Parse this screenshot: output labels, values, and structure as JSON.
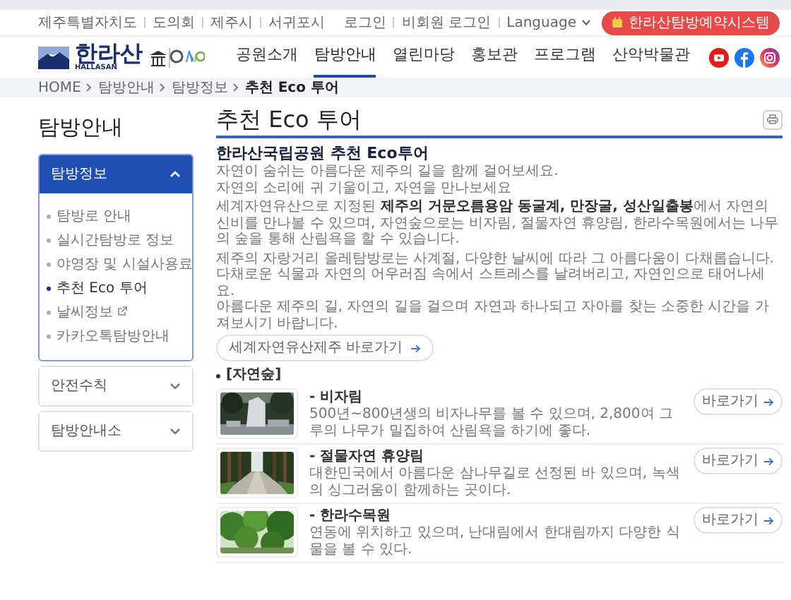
{
  "top_links": [
    "제주특별자치도",
    "도의회",
    "제주시",
    "서귀포시"
  ],
  "account_links": [
    "로그인",
    "비회원 로그인"
  ],
  "language": {
    "label": "Language"
  },
  "reservation_button": "한라산탐방예약시스템",
  "logo": {
    "name": "한라산",
    "subtitle": "HALLASAN"
  },
  "nav": [
    {
      "label": "공원소개",
      "selected": false
    },
    {
      "label": "탐방안내",
      "selected": true
    },
    {
      "label": "열린마당",
      "selected": false
    },
    {
      "label": "홍보관",
      "selected": false
    },
    {
      "label": "프로그램",
      "selected": false
    },
    {
      "label": "산악박물관",
      "selected": false
    }
  ],
  "breadcrumb": [
    "HOME",
    "탐방안내",
    "탐방정보",
    "추천 Eco 투어"
  ],
  "sidebar": {
    "title": "탐방안내",
    "sections": [
      {
        "label": "탐방정보",
        "expanded": true,
        "items": [
          {
            "label": "탐방로 안내",
            "selected": false,
            "external": false
          },
          {
            "label": "실시간탐방로 정보",
            "selected": false,
            "external": false
          },
          {
            "label": "야영장 및 시설사용료",
            "selected": false,
            "external": false
          },
          {
            "label": "추천 Eco 투어",
            "selected": true,
            "external": false
          },
          {
            "label": "날씨정보",
            "selected": false,
            "external": true
          },
          {
            "label": "카카오톡탐방안내",
            "selected": false,
            "external": false
          }
        ]
      },
      {
        "label": "안전수칙",
        "expanded": false
      },
      {
        "label": "탐방안내소",
        "expanded": false
      }
    ]
  },
  "page_title": "추천 Eco 투어",
  "intro": {
    "heading": "한라산국립공원 추천 Eco투어",
    "paragraphs": [
      [
        "자연이 숨쉬는 아름다운 제주의 길을 함께 걸어보세요.",
        "자연의 소리에 귀 기울이고, 자연을 만나보세요"
      ],
      [
        "세계자연유산으로 지정된 **제주의 거문오름용암 동굴계, 만장굴, 성산일출봉**에서 자연의 신비를 만나볼 수 있으며, 자연숲으로는 비자림, 절물자연 휴양림, 한라수목원에서는 나무의 숲을 통해 산림욕을 할 수 있습니다."
      ],
      [
        "제주의 자랑거리 올레탐방로는 사계절, 다양한 날씨에 따라 그 아름다움이 다채롭습니다. 다채로운 식물과 자연의 어우러짐 속에서 스트레스를 날려버리고, 자연인으로 태어나세요.",
        "아름다운 제주의 길, 자연의 길을 걸으며 자연과 하나되고 자아를 찾는 소중한 시간을 가져보시기 바랍니다."
      ]
    ],
    "link_button": "세계자연유산제주 바로가기"
  },
  "section_label": "[자연숲]",
  "places": [
    {
      "title": "- 비자림",
      "description": "500년~800년생의 비자나무를 볼 수 있으며, 2,800여 그루의 나무가 밀집하여 산림욕을 하기에 좋다.",
      "button": "바로가기",
      "kind": "picture"
    },
    {
      "title": "- 절물자연 휴양림",
      "description": "대한민국에서 아름다운 삼나무길로 선정된 바 있으며, 녹색의 싱그러움이 함께하는 곳이다.",
      "button": "바로가기",
      "kind": "picture"
    },
    {
      "title": "- 한라수목원",
      "description": "연동에 위치하고 있으며, 난대림에서 한대림까지 다양한 식물을 볼 수 있다.",
      "button": "바로가기",
      "kind": "picture"
    }
  ]
}
